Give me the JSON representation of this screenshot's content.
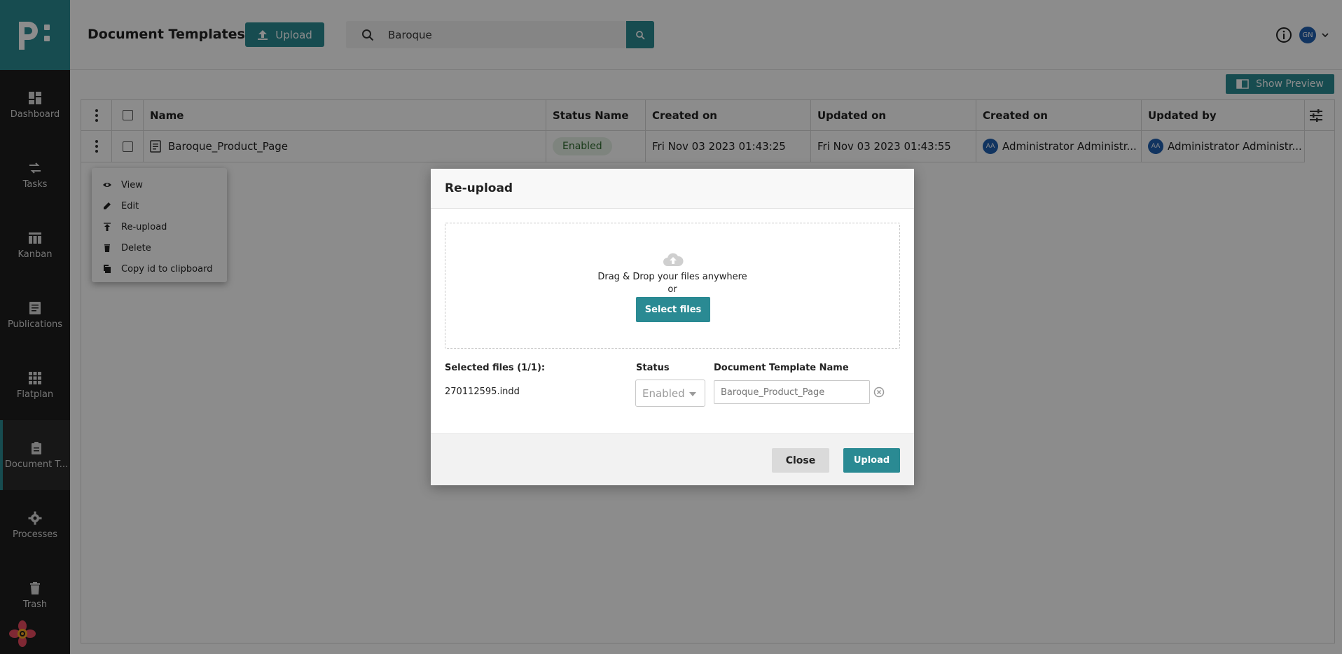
{
  "sidebar": {
    "items": [
      {
        "label": "Dashboard",
        "icon": "dashboard-icon"
      },
      {
        "label": "Tasks",
        "icon": "tasks-icon"
      },
      {
        "label": "Kanban",
        "icon": "kanban-icon"
      },
      {
        "label": "Publications",
        "icon": "publications-icon"
      },
      {
        "label": "Flatplan",
        "icon": "flatplan-icon"
      },
      {
        "label": "Document T...",
        "icon": "document-templates-icon"
      },
      {
        "label": "Processes",
        "icon": "gear-icon"
      },
      {
        "label": "Trash",
        "icon": "trash-icon"
      }
    ]
  },
  "header": {
    "title": "Document Templates",
    "upload_label": "Upload",
    "search_value": "Baroque",
    "avatar_initials": "GN"
  },
  "toolbar": {
    "show_preview_label": "Show Preview"
  },
  "table": {
    "columns": [
      "Name",
      "Status Name",
      "Created on",
      "Updated on",
      "Created on",
      "Updated by"
    ],
    "rows": [
      {
        "name": "Baroque_Product_Page",
        "status": "Enabled",
        "created_on": "Fri Nov 03 2023 01:43:25",
        "updated_on": "Fri Nov 03 2023 01:43:55",
        "created_by_initials": "AA",
        "created_by": "Administrator Administr...",
        "updated_by_initials": "AA",
        "updated_by": "Administrator Administr..."
      }
    ]
  },
  "context_menu": {
    "items": [
      "View",
      "Edit",
      "Re-upload",
      "Delete",
      "Copy id to clipboard"
    ]
  },
  "modal": {
    "title": "Re-upload",
    "dropzone_text": "Drag & Drop your files anywhere",
    "dropzone_or": "or",
    "select_files_label": "Select files",
    "selected_files_label": "Selected files (1/1):",
    "status_label": "Status",
    "template_name_label": "Document Template Name",
    "file_name": "270112595.indd",
    "status_value": "Enabled",
    "template_name_placeholder": "Baroque_Product_Page",
    "close_label": "Close",
    "upload_label": "Upload"
  },
  "colors": {
    "accent": "#2a8a93",
    "sidebar_bg": "#1e1e1e",
    "avatar": "#1f5fb0"
  }
}
